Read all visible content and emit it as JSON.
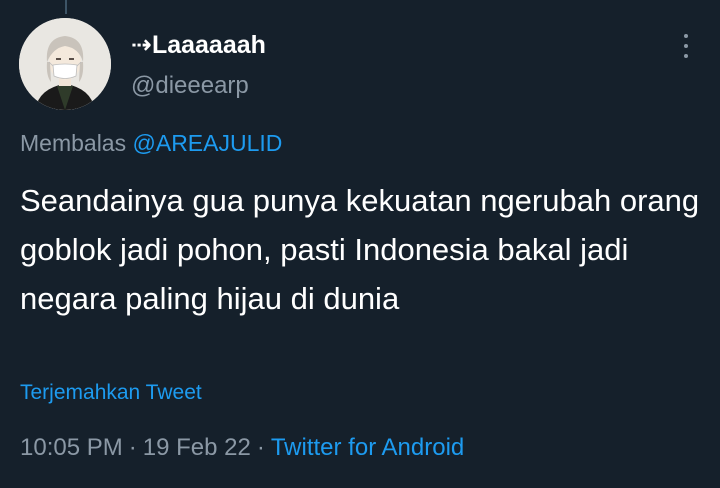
{
  "author": {
    "display_name": "⇢Laaaaaah",
    "handle": "@dieeearp"
  },
  "reply": {
    "prefix": "Membalas",
    "mention": "@AREAJULID"
  },
  "tweet": {
    "text": "Seandainya gua punya kekuatan ngerubah orang goblok jadi pohon, pasti Indonesia bakal jadi negara paling hijau di dunia",
    "translate_label": "Terjemahkan Tweet"
  },
  "meta": {
    "time": "10:05 PM",
    "separator": "·",
    "date": "19 Feb 22",
    "source": "Twitter for Android"
  },
  "colors": {
    "background": "#15202b",
    "accent": "#1d9bf0",
    "secondary_text": "#8b98a5"
  }
}
